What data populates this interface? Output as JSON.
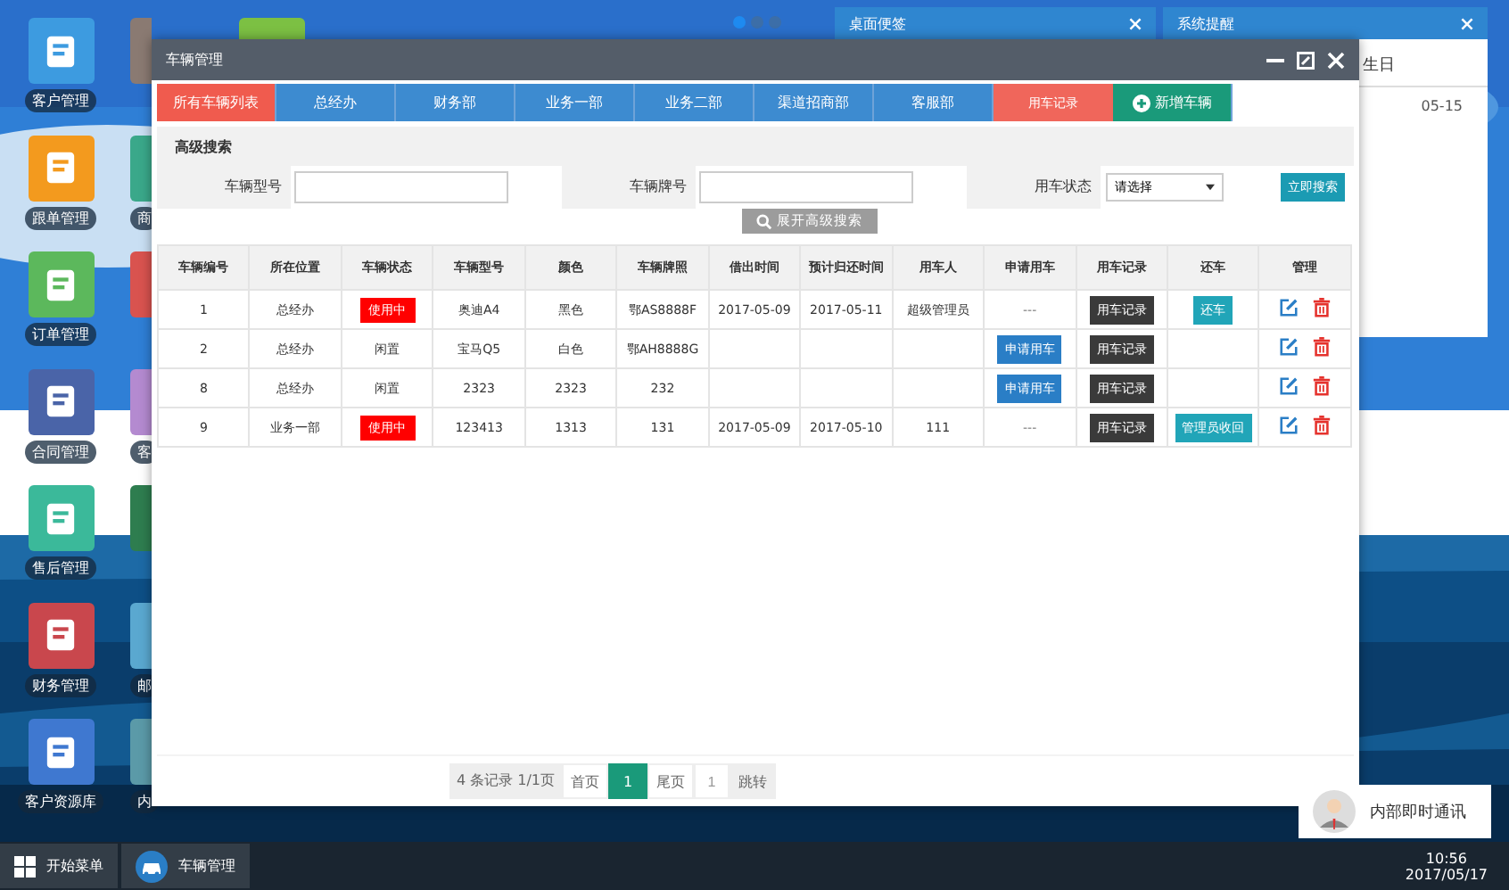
{
  "desktop": {
    "icons_col1": [
      {
        "label": "客户管理",
        "color": "#3d9be0"
      },
      {
        "label": "跟单管理",
        "color": "#f39a1e"
      },
      {
        "label": "订单管理",
        "color": "#5cb85c"
      },
      {
        "label": "合同管理",
        "color": "#4a64a8"
      },
      {
        "label": "售后管理",
        "color": "#3bb99a"
      },
      {
        "label": "财务管理",
        "color": "#c9474d"
      },
      {
        "label": "客户资源库",
        "color": "#3f78d0"
      }
    ],
    "icons_col2": [
      {
        "color": "#8a7a72"
      },
      {
        "label": "商",
        "color": "#3aa88a"
      },
      {
        "color": "#d9534f"
      },
      {
        "label": "客",
        "color": "#b48ad0"
      },
      {
        "color": "#2e7d4f"
      },
      {
        "label": "邮",
        "color": "#5aa8d0"
      },
      {
        "label": "内",
        "color": "#5b9aa8"
      }
    ],
    "top_icon": {
      "color": "#7cc043"
    },
    "pager_dots": [
      {
        "selected": true
      },
      {
        "selected": false
      },
      {
        "selected": false
      }
    ]
  },
  "note_widget": {
    "title": "桌面便签"
  },
  "reminder_widget": {
    "title": "系统提醒",
    "heading": "生日",
    "date": "05-15"
  },
  "window": {
    "title": "车辆管理"
  },
  "tabs": [
    {
      "label": "所有车辆列表",
      "kind": "dept",
      "selected": true
    },
    {
      "label": "总经办",
      "kind": "dept",
      "selected": false
    },
    {
      "label": "财务部",
      "kind": "dept",
      "selected": false
    },
    {
      "label": "业务一部",
      "kind": "dept",
      "selected": false
    },
    {
      "label": "业务二部",
      "kind": "dept",
      "selected": false
    },
    {
      "label": "渠道招商部",
      "kind": "dept",
      "selected": false
    },
    {
      "label": "客服部",
      "kind": "dept",
      "selected": false
    },
    {
      "label": "用车记录",
      "kind": "record",
      "selected": false
    },
    {
      "label": "新增车辆",
      "kind": "add",
      "selected": false
    }
  ],
  "search": {
    "title": "高级搜索",
    "model_label": "车辆型号",
    "plate_label": "车辆牌号",
    "status_label": "用车状态",
    "status_value": "请选择",
    "search_button": "立即搜索",
    "expand_button": "展开高级搜索"
  },
  "table": {
    "columns": [
      "车辆编号",
      "所在位置",
      "车辆状态",
      "车辆型号",
      "颜色",
      "车辆牌照",
      "借出时间",
      "预计归还时间",
      "用车人",
      "申请用车",
      "用车记录",
      "还车",
      "管理"
    ],
    "rows": [
      {
        "id": "1",
        "location": "总经办",
        "status": "使用中",
        "in_use": true,
        "model": "奥迪A4",
        "car_color": "黑色",
        "plate": "鄂AS8888F",
        "out_time": "2017-05-09",
        "due_time": "2017-05-11",
        "user": "超级管理员",
        "apply": {
          "kind": "text",
          "text": "---"
        },
        "record": "用车记录",
        "return": "还车"
      },
      {
        "id": "2",
        "location": "总经办",
        "status": "闲置",
        "in_use": false,
        "model": "宝马Q5",
        "car_color": "白色",
        "plate": "鄂AH8888G",
        "apply": {
          "kind": "button",
          "text": "申请用车"
        },
        "record": "用车记录"
      },
      {
        "id": "8",
        "location": "总经办",
        "status": "闲置",
        "in_use": false,
        "model": "2323",
        "car_color": "2323",
        "plate": "232",
        "apply": {
          "kind": "button",
          "text": "申请用车"
        },
        "record": "用车记录"
      },
      {
        "id": "9",
        "location": "业务一部",
        "status": "使用中",
        "in_use": true,
        "model": "123413",
        "car_color": "1313",
        "plate": "131",
        "out_time": "2017-05-09",
        "due_time": "2017-05-10",
        "user": "111",
        "apply": {
          "kind": "text",
          "text": "---"
        },
        "record": "用车记录",
        "return": "管理员收回"
      }
    ]
  },
  "pagination": {
    "summary": "4 条记录 1/1页",
    "first": "首页",
    "pages": [
      {
        "label": "1",
        "selected": true
      }
    ],
    "last": "尾页",
    "jump_value": "1",
    "jump": "跳转"
  },
  "chat": {
    "label": "内部即时通讯"
  },
  "taskbar": {
    "start": "开始菜单",
    "apps": [
      "车辆管理"
    ],
    "time": "10:56",
    "date": "2017/05/17"
  }
}
